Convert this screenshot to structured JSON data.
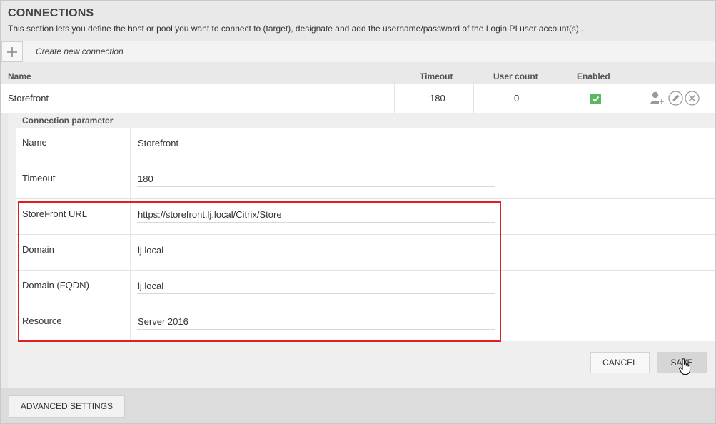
{
  "header": {
    "title": "CONNECTIONS",
    "description": "This section lets you define the host or pool you want to connect to (target), designate and add the username/password of the Login PI user account(s).."
  },
  "toolbar": {
    "add_icon": "plus-icon",
    "create_label": "Create new connection"
  },
  "table": {
    "columns": [
      "Name",
      "Timeout",
      "User count",
      "Enabled"
    ],
    "rows": [
      {
        "name": "Storefront",
        "timeout": "180",
        "user_count": "0",
        "enabled": true,
        "actions": [
          "add-user-icon",
          "edit-icon",
          "delete-icon"
        ]
      }
    ]
  },
  "params": {
    "heading": "Connection parameter",
    "fields": [
      {
        "label": "Name",
        "value": "Storefront"
      },
      {
        "label": "Timeout",
        "value": "180"
      },
      {
        "label": "StoreFront URL",
        "value": "https://storefront.lj.local/Citrix/Store"
      },
      {
        "label": "Domain",
        "value": "lj.local"
      },
      {
        "label": "Domain (FQDN)",
        "value": "lj.local"
      },
      {
        "label": "Resource",
        "value": "Server 2016"
      }
    ]
  },
  "buttons": {
    "cancel": "CANCEL",
    "save": "SAVE",
    "advanced": "ADVANCED SETTINGS"
  },
  "colors": {
    "enabled_green": "#5cb85c",
    "highlight_red": "#e02020"
  }
}
